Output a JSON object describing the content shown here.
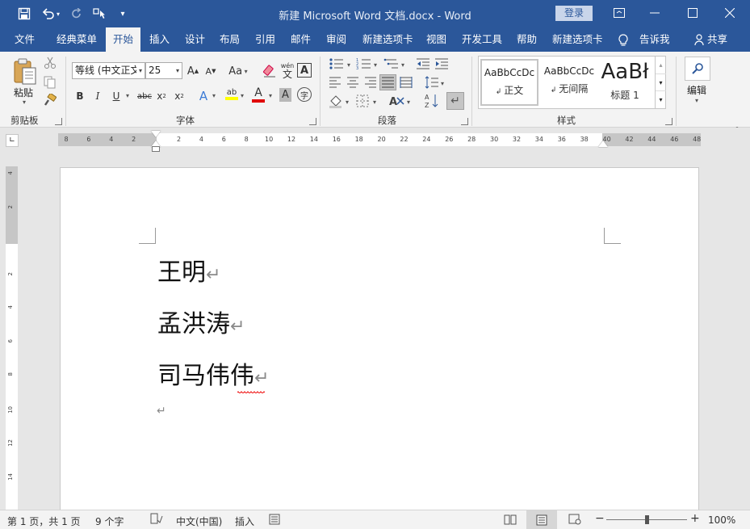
{
  "titlebar": {
    "title": "新建 Microsoft Word 文档.docx  -  Word",
    "login_label": "登录"
  },
  "tabs": [
    {
      "label": "文件"
    },
    {
      "label": "经典菜单"
    },
    {
      "label": "开始"
    },
    {
      "label": "插入"
    },
    {
      "label": "设计"
    },
    {
      "label": "布局"
    },
    {
      "label": "引用"
    },
    {
      "label": "邮件"
    },
    {
      "label": "审阅"
    },
    {
      "label": "新建选项卡"
    },
    {
      "label": "视图"
    },
    {
      "label": "开发工具"
    },
    {
      "label": "帮助"
    },
    {
      "label": "新建选项卡"
    },
    {
      "label": "告诉我"
    },
    {
      "label": "共享"
    }
  ],
  "ribbon": {
    "clipboard": {
      "paste_label": "粘贴",
      "group_label": "剪贴板"
    },
    "font": {
      "font_name": "等线 (中文正文",
      "font_size": "25",
      "group_label": "字体",
      "grow_label": "A",
      "shrink_label": "A",
      "case_label": "Aa",
      "phonetic_label": "wén",
      "bold_label": "B",
      "italic_label": "I",
      "underline_label": "U",
      "strike_label": "abc",
      "subscript_label": "x",
      "superscript_label": "x",
      "effects_label": "A",
      "highlight_label": "ab",
      "color_label": "A",
      "shading_label": "A",
      "enclose_label": "字"
    },
    "paragraph": {
      "group_label": "段落"
    },
    "styles": {
      "group_label": "样式",
      "items": [
        {
          "preview": "AaBbCcDc",
          "name": "正文"
        },
        {
          "preview": "AaBbCcDc",
          "name": "无间隔"
        },
        {
          "preview": "AaBł",
          "name": "标题 1"
        }
      ]
    },
    "editing": {
      "label": "编辑"
    }
  },
  "ruler": {
    "ticks": [
      "8",
      "6",
      "4",
      "2",
      "",
      "2",
      "4",
      "6",
      "8",
      "10",
      "12",
      "14",
      "16",
      "18",
      "20",
      "22",
      "24",
      "26",
      "28",
      "30",
      "32",
      "34",
      "36",
      "38",
      "40",
      "42",
      "44",
      "46",
      "48"
    ]
  },
  "document": {
    "lines": [
      "王明",
      "孟洪涛",
      "司马伟伟"
    ],
    "paragraph_mark": "↵"
  },
  "statusbar": {
    "page_info": "第 1 页，共 1 页",
    "word_count": "9 个字",
    "language": "中文(中国)",
    "insert_mode": "插入",
    "zoom_minus": "−",
    "zoom_plus": "+",
    "zoom_level": "100%",
    "zoom_fraction": 0.5
  }
}
